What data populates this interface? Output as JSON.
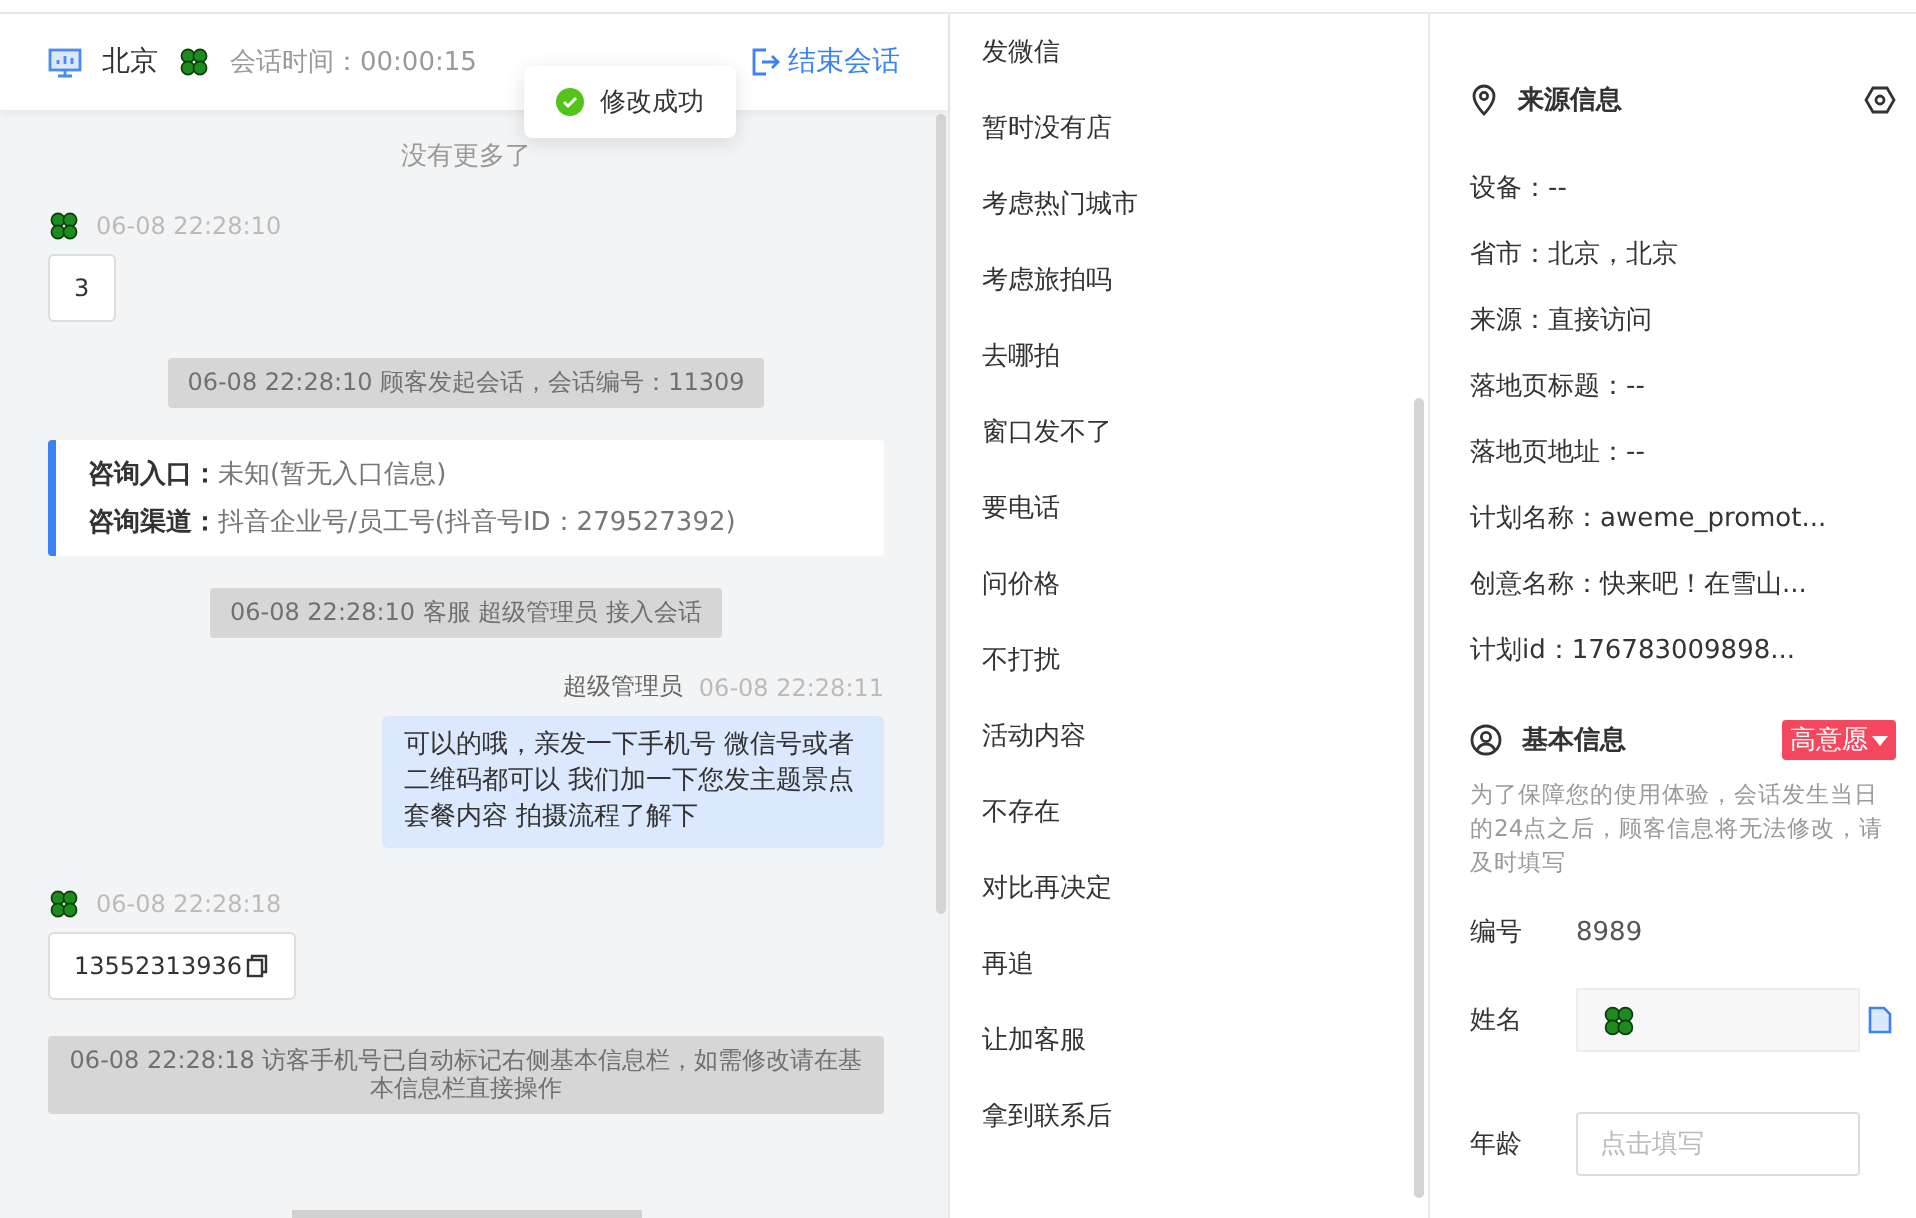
{
  "header": {
    "location": "北京",
    "session_time": "会话时间：00:00:15",
    "end_button": "结束会话"
  },
  "toast": {
    "text": "修改成功"
  },
  "messages": [
    {
      "kind": "notice",
      "text": "没有更多了"
    },
    {
      "kind": "visitor",
      "time": "06-08 22:28:10",
      "text": "3",
      "copy": false
    },
    {
      "kind": "system",
      "text": "06-08 22:28:10 顾客发起会话，会话编号：11309"
    },
    {
      "kind": "entry",
      "lines": [
        {
          "label": "咨询入口：",
          "value": "未知(暂无入口信息)"
        },
        {
          "label": "咨询渠道：",
          "value": "抖音企业号/员工号(抖音号ID：279527392)"
        }
      ]
    },
    {
      "kind": "system",
      "text": "06-08 22:28:10 客服 超级管理员 接入会话"
    },
    {
      "kind": "agent",
      "name": "超级管理员",
      "time": "06-08 22:28:11",
      "text": "可以的哦，亲发一下手机号 微信号或者二维码都可以 我们加一下您发主题景点套餐内容 拍摄流程了解下"
    },
    {
      "kind": "visitor",
      "time": "06-08 22:28:18",
      "text": "13552313936",
      "copy": true
    },
    {
      "kind": "system",
      "text": "06-08 22:28:18 访客手机号已自动标记右侧基本信息栏，如需修改请在基本信息栏直接操作"
    }
  ],
  "quick_replies": [
    "发微信",
    "暂时没有店",
    "考虑热门城市",
    "考虑旅拍吗",
    "去哪拍",
    "窗口发不了",
    "要电话",
    "问价格",
    "不打扰",
    "活动内容",
    "不存在",
    "对比再决定",
    "再追",
    "让加客服",
    "拿到联系后"
  ],
  "source_info": {
    "title": "来源信息",
    "rows": [
      "设备：--",
      "省市：北京，北京",
      "来源：直接访问",
      "落地页标题：--",
      "落地页地址：--",
      "计划名称：aweme_promot...",
      "创意名称：快来吧！在雪山...",
      "计划id：176783009898..."
    ]
  },
  "basic_info": {
    "title": "基本信息",
    "tag": "高意愿",
    "note": "为了保障您的使用体验，会话发生当日的24点之后，顾客信息将无法修改，请及时填写",
    "fields": [
      {
        "kind": "text",
        "label": "编号",
        "value": "8989"
      },
      {
        "kind": "avatar",
        "label": "姓名"
      },
      {
        "kind": "input",
        "label": "年龄",
        "placeholder": "点击填写"
      }
    ]
  }
}
